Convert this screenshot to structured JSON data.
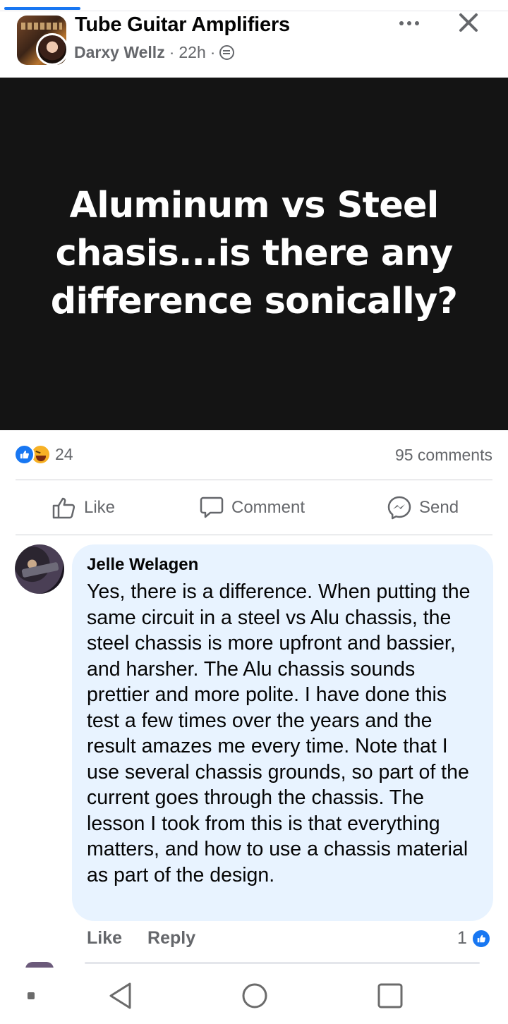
{
  "header": {
    "group_name": "Tube Guitar Amplifiers",
    "author": "Darxy Wellz",
    "separator": "·",
    "time": "22h",
    "privacy_icon": "globe-icon",
    "more_icon": "more-icon",
    "close_icon": "close-icon"
  },
  "post": {
    "image_text": "Aluminum vs Steel chasis...is there any difference sonically?",
    "background_color": "#141414"
  },
  "stats": {
    "reaction_icons": [
      "like-icon",
      "haha-icon"
    ],
    "reaction_count": "24",
    "comments_count": "95 comments"
  },
  "actions": {
    "like": "Like",
    "comment": "Comment",
    "send": "Send"
  },
  "comment": {
    "author": "Jelle Welagen",
    "text": "Yes, there is a difference. When putting the same circuit in a steel vs Alu chassis, the steel chassis is more upfront and bassier, and harsher. The Alu chassis sounds prettier and more polite. I have done this test a few times over the years and the result amazes me every time. Note that I use several chassis grounds, so part of the current goes through the chassis. The lesson I took from this is that everything matters, and how to use a chassis material as part of the design.",
    "like_label": "Like",
    "reply_label": "Reply",
    "like_count": "1",
    "bubble_color": "#e8f3ff"
  },
  "navbar": {
    "back_icon": "back-triangle-icon",
    "home_icon": "home-circle-icon",
    "recents_icon": "recents-square-icon"
  },
  "colors": {
    "accent": "#1877f2",
    "secondary_text": "#65676b"
  }
}
